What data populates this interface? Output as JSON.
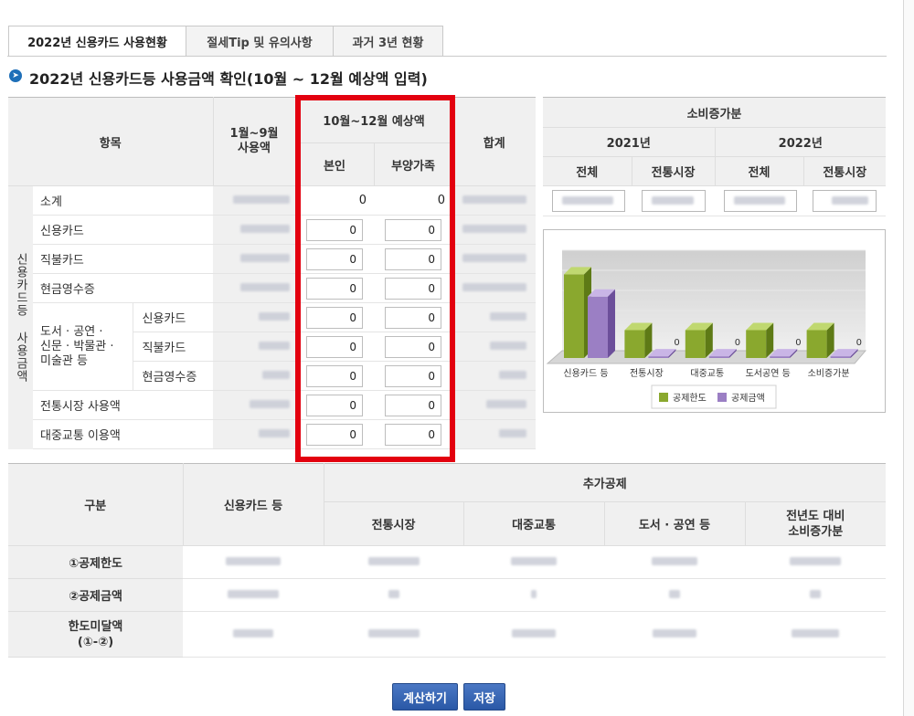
{
  "tabs": [
    {
      "label": "2022년 신용카드 사용현황",
      "active": true
    },
    {
      "label": "절세Tip 및 유의사항",
      "active": false
    },
    {
      "label": "과거 3년 현황",
      "active": false
    }
  ],
  "section_title": "2022년 신용카드등 사용금액 확인(10월 ~ 12월 예상액 입력)",
  "main_table": {
    "headers": {
      "item": "항목",
      "jan_sep": "1월~9월\n사용액",
      "oct_dec": "10월~12월 예상액",
      "self": "본인",
      "dependents": "부양가족",
      "total": "합계"
    },
    "vertical_group_label": "신용카드등 사용금액",
    "subtotal_label": "소계",
    "subtotal_self": "0",
    "subtotal_dependents": "0",
    "rows": [
      {
        "label": "신용카드",
        "self": "0",
        "dependents": "0"
      },
      {
        "label": "직불카드",
        "self": "0",
        "dependents": "0"
      },
      {
        "label": "현금영수증",
        "self": "0",
        "dependents": "0"
      }
    ],
    "culture_group_label": "도서 · 공연 ·\n신문 · 박물관 ·\n미술관 등",
    "culture_rows": [
      {
        "label": "신용카드",
        "self": "0",
        "dependents": "0"
      },
      {
        "label": "직불카드",
        "self": "0",
        "dependents": "0"
      },
      {
        "label": "현금영수증",
        "self": "0",
        "dependents": "0"
      }
    ],
    "extra_rows": [
      {
        "label": "전통시장 사용액",
        "self": "0",
        "dependents": "0"
      },
      {
        "label": "대중교통 이용액",
        "self": "0",
        "dependents": "0"
      }
    ]
  },
  "increase_table": {
    "title": "소비증가분",
    "years": [
      "2021년",
      "2022년"
    ],
    "cols": [
      "전체",
      "전통시장",
      "전체",
      "전통시장"
    ]
  },
  "chart_data": {
    "type": "bar",
    "categories": [
      "신용카드 등",
      "전통시장",
      "대중교통",
      "도서공연 등",
      "소비증가분"
    ],
    "series": [
      {
        "name": "공제한도",
        "values": [
          3.0,
          1.0,
          1.0,
          1.0,
          1.0
        ]
      },
      {
        "name": "공제금액",
        "values": [
          2.2,
          0,
          0,
          0,
          0
        ]
      }
    ],
    "data_labels": [
      "",
      "0",
      "0",
      "0",
      "0"
    ],
    "legend_placement": "bottom",
    "colors": {
      "series1": "#8aa82e",
      "series2": "#9b7fc4"
    }
  },
  "bottom_table": {
    "headers": {
      "category": "구분",
      "credit": "신용카드 등",
      "additional": "추가공제",
      "market": "전통시장",
      "transit": "대중교통",
      "culture": "도서 · 공연 등",
      "increase": "전년도 대비\n소비증가분"
    },
    "rows": [
      {
        "label": "①공제한도"
      },
      {
        "label": "②공제금액"
      },
      {
        "label": "한도미달액\n(①-②)"
      }
    ]
  },
  "buttons": {
    "calculate": "계산하기",
    "save": "저장"
  },
  "colors": {
    "accent": "#1e6fb8",
    "button": "#2a58a6",
    "highlight": "#e3000f",
    "header_bg": "#f0f0f0"
  }
}
